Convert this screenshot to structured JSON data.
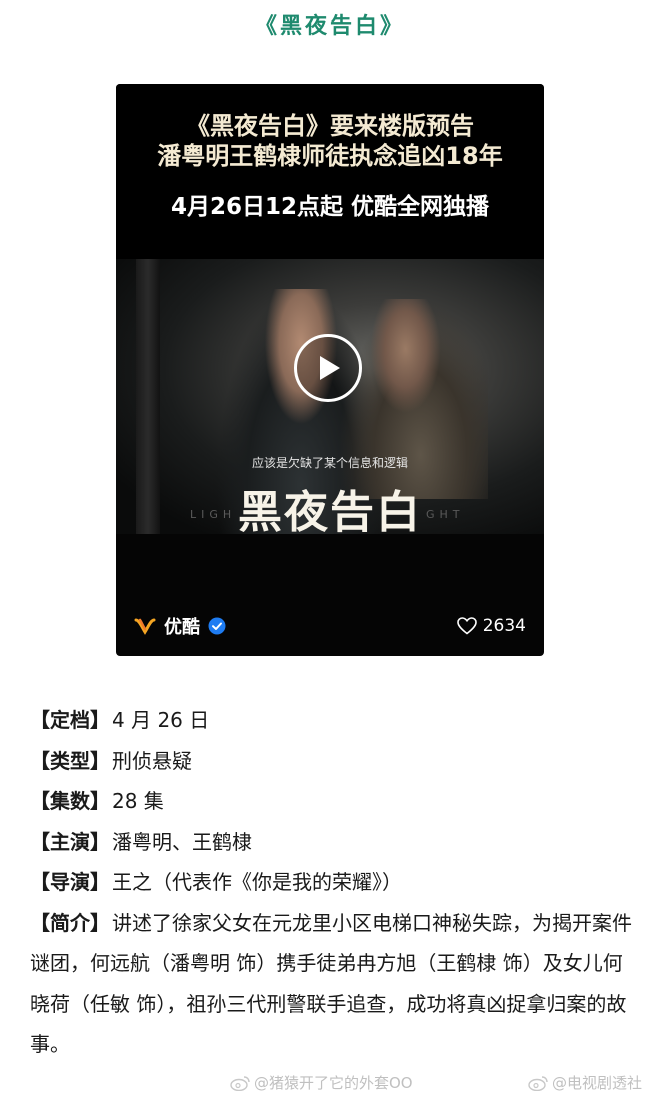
{
  "header": {
    "title": "《黑夜告白》"
  },
  "video_card": {
    "promo_line1": "《黑夜告白》要来楼版预告",
    "promo_line2": "潘粤明王鹤棣师徒执念追凶18年",
    "promo_line3": "4月26日12点起 优酷全网独播",
    "subtitle": "应该是欠缺了某个信息和逻辑",
    "logo_art": "黑夜告白",
    "logo_en_left": "LIGH",
    "logo_en_right": "GHT",
    "brand_name": "优酷",
    "like_count": "2634",
    "icons": {
      "brand": "youku-logo-icon",
      "verified": "verified-badge-icon",
      "like": "heart-icon",
      "play": "play-icon"
    }
  },
  "info": {
    "schedule": {
      "label": "【定档】",
      "value": "4 月 26 日"
    },
    "genre": {
      "label": "【类型】",
      "value": "刑侦悬疑"
    },
    "episodes": {
      "label": "【集数】",
      "value": "28 集"
    },
    "cast": {
      "label": "【主演】",
      "value": "潘粤明、王鹤棣"
    },
    "director": {
      "label": "【导演】",
      "value": "王之（代表作《你是我的荣耀》）"
    },
    "synopsis": {
      "label": "【简介】",
      "value": "讲述了徐家父女在元龙里小区电梯口神秘失踪，为揭开案件谜团，何远航（潘粤明 饰）携手徒弟冉方旭（王鹤棣 饰）及女儿何晓荷（任敏 饰），祖孙三代刑警联手追查，成功将真凶捉拿归案的故事。"
    }
  },
  "watermarks": {
    "left": "@猪猿开了它的外套OO",
    "right": "@电视剧透社"
  },
  "colors": {
    "title_green": "#1e8a6e",
    "youku_orange": "#f5a623",
    "verified_blue": "#1e7cf2"
  }
}
